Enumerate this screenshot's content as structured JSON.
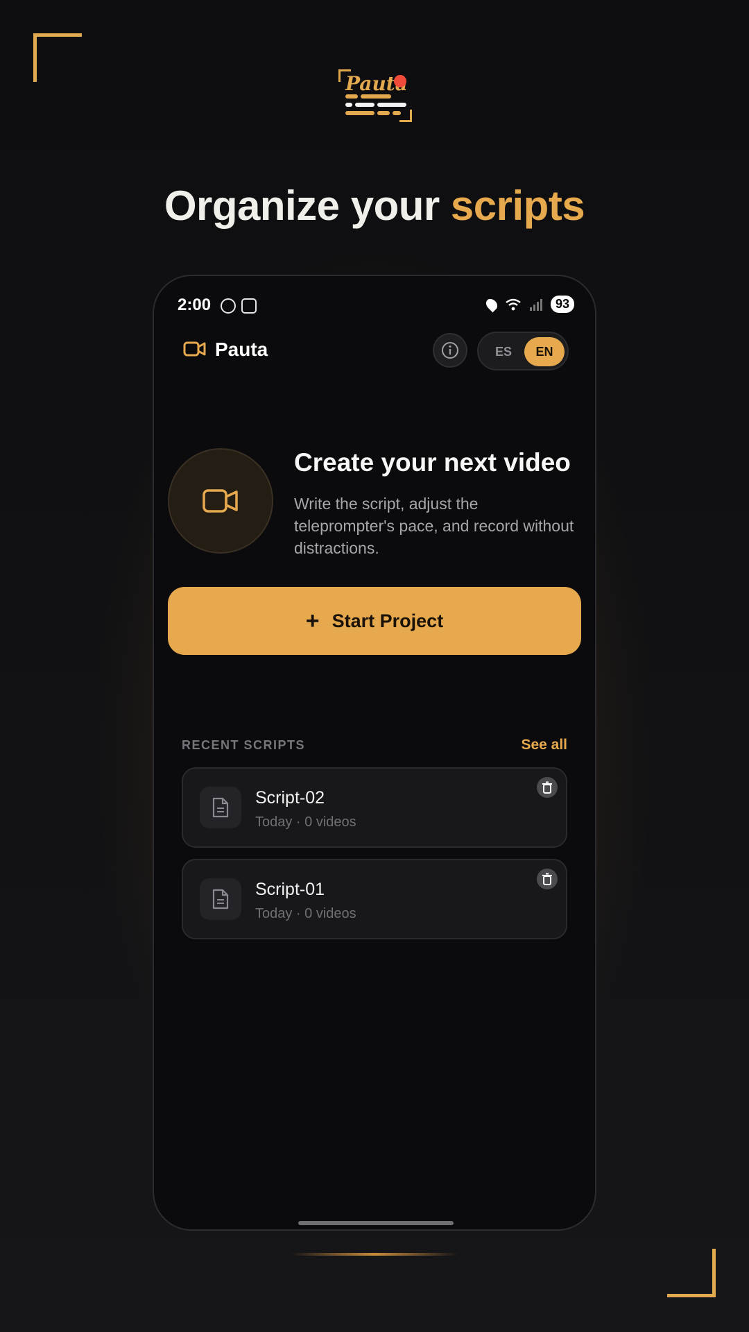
{
  "headline": {
    "prefix": "Organize your ",
    "accent": "scripts"
  },
  "logo": {
    "wordmark": "Pauta"
  },
  "status_bar": {
    "time": "2:00",
    "battery": "93"
  },
  "app_bar": {
    "title": "Pauta",
    "lang_es": "ES",
    "lang_en": "EN",
    "selected_lang": "EN"
  },
  "hero": {
    "title": "Create your next video",
    "description": "Write the script, adjust the teleprompter's pace, and record without distractions."
  },
  "start_button": {
    "label": "Start Project"
  },
  "recent": {
    "heading": "RECENT SCRIPTS",
    "see_all": "See all",
    "items": [
      {
        "name": "Script-02",
        "meta": "Today · 0 videos"
      },
      {
        "name": "Script-01",
        "meta": "Today · 0 videos"
      }
    ]
  },
  "colors": {
    "accent": "#e6a94e",
    "background": "#0b0b0d",
    "card": "#18181b",
    "record_dot": "#ef4a3a"
  },
  "icons": [
    "video-camera-icon",
    "info-icon",
    "document-icon",
    "trash-icon",
    "plus-icon",
    "location-icon",
    "wifi-icon",
    "signal-icon"
  ]
}
